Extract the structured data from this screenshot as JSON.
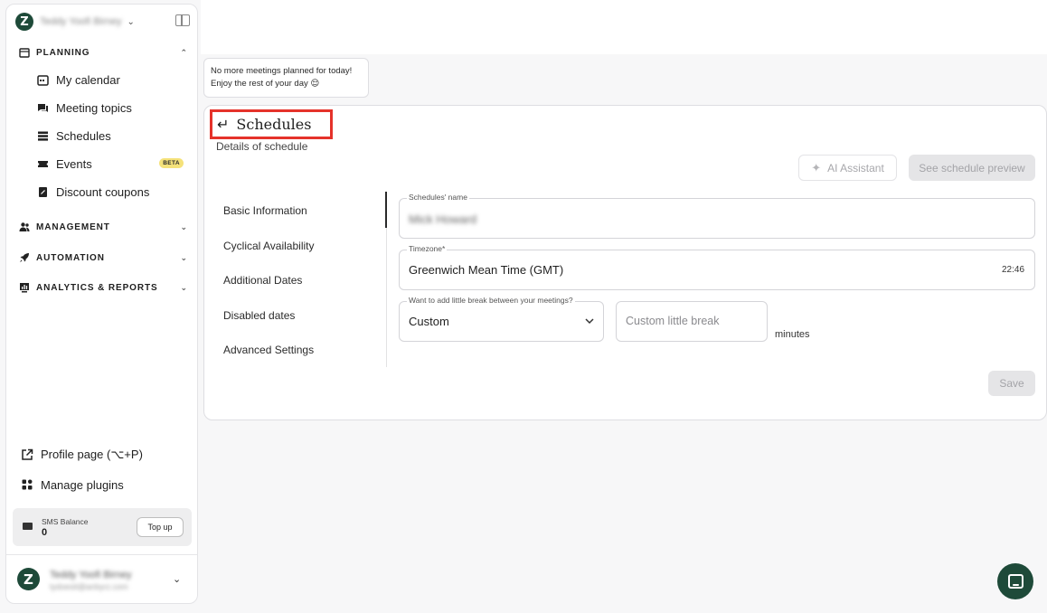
{
  "workspace": {
    "name": "Teddy Yoofi Birney"
  },
  "sidebar": {
    "sections": [
      {
        "label": "PLANNING",
        "icon": "calendar-icon",
        "expanded": true
      },
      {
        "label": "MANAGEMENT",
        "icon": "users-icon",
        "expanded": false
      },
      {
        "label": "AUTOMATION",
        "icon": "rocket-icon",
        "expanded": false
      },
      {
        "label": "ANALYTICS & REPORTS",
        "icon": "chart-icon",
        "expanded": false
      }
    ],
    "planning_items": [
      {
        "label": "My calendar",
        "icon": "calendar-icon"
      },
      {
        "label": "Meeting topics",
        "icon": "chat-bubbles-icon"
      },
      {
        "label": "Schedules",
        "icon": "stack-icon"
      },
      {
        "label": "Events",
        "icon": "ticket-icon",
        "badge": "BETA"
      },
      {
        "label": "Discount coupons",
        "icon": "coupon-icon"
      }
    ],
    "profile_link": "Profile page (⌥+P)",
    "plugins_link": "Manage plugins",
    "sms": {
      "label": "SMS Balance",
      "value": "0",
      "button": "Top up"
    },
    "user": {
      "name": "Teddy Yoofi Birney",
      "email": "tydoesit@anbyrz.com"
    }
  },
  "notice": {
    "line1": "No more meetings planned for today!",
    "line2": "Enjoy the rest of your day 😌"
  },
  "page": {
    "title": "Schedules",
    "subtitle": "Details of schedule",
    "ai_button": "AI Assistant",
    "preview_button": "See schedule preview",
    "save_button": "Save"
  },
  "tabs": [
    "Basic Information",
    "Cyclical Availability",
    "Additional Dates",
    "Disabled dates",
    "Advanced Settings"
  ],
  "form": {
    "name_label": "Schedules' name",
    "name_value": "Mick Howard",
    "timezone_label": "Timezone*",
    "timezone_value": "Greenwich Mean Time (GMT)",
    "timezone_time": "22:46",
    "break_label": "Want to add little break between your meetings?",
    "break_select": "Custom",
    "custom_placeholder": "Custom little break",
    "unit": "minutes"
  },
  "colors": {
    "brand": "#1e4a39",
    "highlight": "#e5322a",
    "beta": "#f5e27a"
  }
}
